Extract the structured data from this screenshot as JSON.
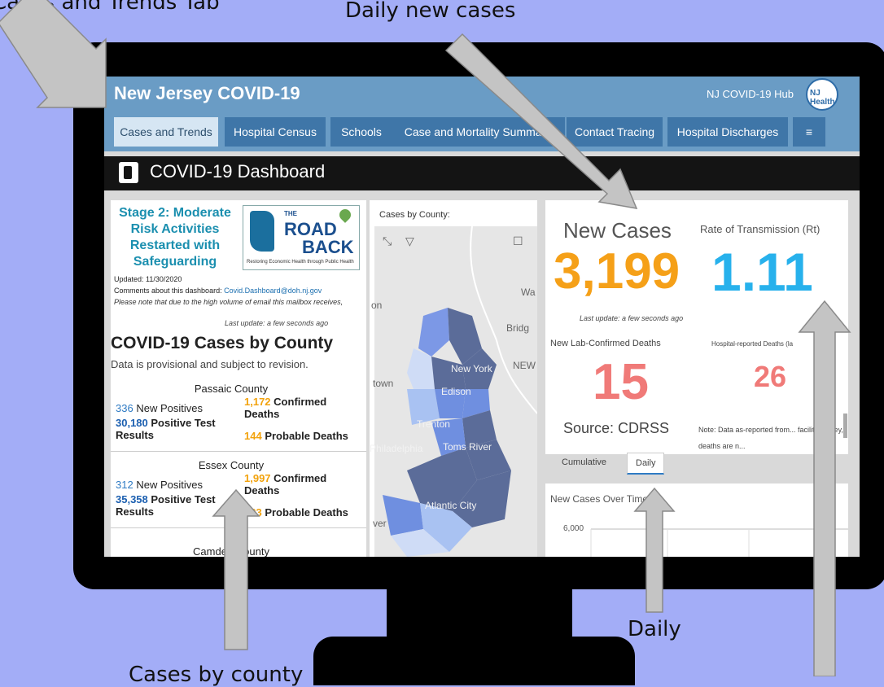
{
  "captions": {
    "cases_tab": "Cases and Trends Tab",
    "daily_new": "Daily new cases",
    "daily": "Daily",
    "by_county": "Cases by county"
  },
  "header": {
    "title": "New Jersey COVID-19",
    "hub_link": "NJ COVID-19 Hub",
    "logo_text": "NJ Health"
  },
  "tabs": [
    {
      "label": "Cases and Trends"
    },
    {
      "label": "Hospital Census"
    },
    {
      "label": "Schools"
    },
    {
      "label": "Case and Mortality Summary"
    },
    {
      "label": "Contact Tracing"
    },
    {
      "label": "Hospital Discharges"
    },
    {
      "label": "≡"
    }
  ],
  "dashboard_title": "COVID-19 Dashboard",
  "left": {
    "stage_text": "Stage 2: Moderate Risk Activities Restarted with Safeguarding",
    "roadback": {
      "the": "THE",
      "road": "ROAD",
      "back": "BACK",
      "tagline": "Restoring Economic Health through Public Health"
    },
    "updated": "Updated: 11/30/2020",
    "comments_label": "Comments about this dashboard:",
    "comments_email": "Covid.Dashboard@doh.nj.gov",
    "note": "Please note that due to the high volume of email this mailbox receives,",
    "last_update": "Last update: a few seconds ago",
    "heading": "COVID-19 Cases by County",
    "provisional": "Data is provisional and subject to revision.",
    "counties": [
      {
        "name": "Passaic County",
        "new_positives": "336",
        "new_positives_label": "New Positives",
        "confirmed_deaths": "1,172",
        "confirmed_label": "Confirmed Deaths",
        "positive_tests": "30,180",
        "positive_tests_label": "Positive Test Results",
        "probable_deaths": "144",
        "probable_label": "Probable Deaths"
      },
      {
        "name": "Essex County",
        "new_positives": "312",
        "new_positives_label": "New Positives",
        "confirmed_deaths": "1,997",
        "confirmed_label": "Confirmed Deaths",
        "positive_tests": "35,358",
        "positive_tests_label": "Positive Test Results",
        "probable_deaths": "233",
        "probable_label": "Probable Deaths"
      }
    ],
    "next_county": "Camden County"
  },
  "map": {
    "title": "Cases by County:",
    "labels": [
      "New York",
      "Edison",
      "Trenton",
      "Toms River",
      "Atlantic City",
      "Philadelphia",
      "Bridg",
      "Wa",
      "town",
      "on",
      "NEW",
      "ver"
    ],
    "colors": {
      "dark": "#5b6c99",
      "mid": "#6f8fe0",
      "light": "#a9c2f2",
      "pale": "#cfdcf6"
    }
  },
  "kpi": {
    "new_cases_label": "New Cases",
    "new_cases_value": "3,199",
    "rt_label": "Rate of Transmission (Rt)",
    "rt_value": "1.11",
    "last_update": "Last update: a few seconds ago",
    "lab_deaths_label": "New Lab-Confirmed Deaths",
    "lab_deaths_value": "15",
    "hosp_deaths_label": "Hospital-reported Deaths (la",
    "hosp_deaths_value": "26",
    "source": "Source: CDRSS",
    "hosp_note": "Note: Data as-reported from... facility survey, deaths are n...",
    "colors": {
      "orange": "#f5a018",
      "blue": "#27b1ec",
      "red": "#f07a78"
    }
  },
  "subtabs": [
    {
      "label": "Cumulative"
    },
    {
      "label": "Daily"
    }
  ],
  "chart": {
    "title": "New Cases Over Time",
    "tick": "6,000"
  }
}
